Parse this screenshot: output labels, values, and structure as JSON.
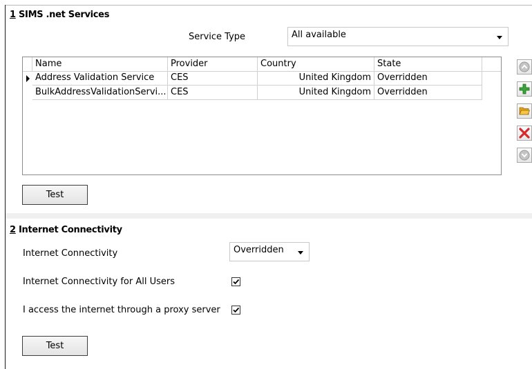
{
  "section1": {
    "number": "1",
    "title": "SIMS .net Services",
    "service_type_label": "Service Type",
    "service_type_value": "All available",
    "grid": {
      "columns": [
        "Name",
        "Provider",
        "Country",
        "State"
      ],
      "rows": [
        {
          "name": "Address Validation Service",
          "provider": "CES",
          "country": "United Kingdom",
          "state": "Overridden"
        },
        {
          "name": "BulkAddressValidationServi...",
          "provider": "CES",
          "country": "United Kingdom",
          "state": "Overridden"
        }
      ]
    },
    "side_buttons": [
      "up-icon",
      "add-icon",
      "open-folder-icon",
      "delete-icon",
      "down-icon"
    ],
    "test_label": "Test"
  },
  "section2": {
    "number": "2",
    "title": "Internet Connectivity",
    "connectivity_label": "Internet Connectivity",
    "connectivity_value": "Overridden",
    "all_users_label": "Internet Connectivity for All Users",
    "all_users_checked": true,
    "proxy_label": "I access the internet through a proxy server",
    "proxy_checked": true,
    "test_label": "Test"
  },
  "colors": {
    "add": "#3aa33a",
    "delete": "#d62a2a",
    "folder": "#f0b323",
    "disabled": "#b8b8b8"
  }
}
